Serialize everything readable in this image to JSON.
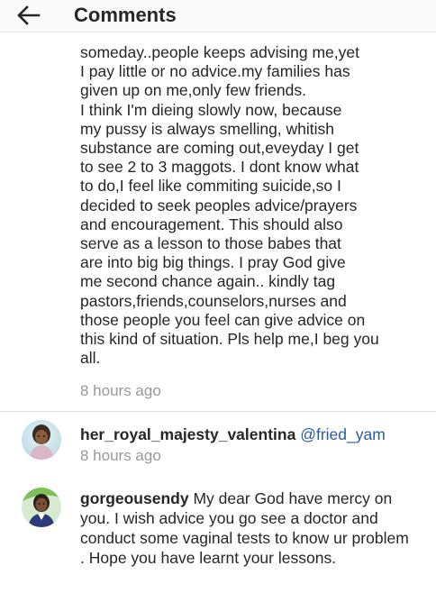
{
  "header": {
    "title": "Comments",
    "back_icon": "arrow-left-icon"
  },
  "comments": [
    {
      "text": "someday..people keeps advising me,yet\nI pay little or no advice.my families has\ngiven up on me,only few friends.\nI think I'm dieing slowly now, because\nmy pussy is always smelling, whitish\nsubstance are coming out,eveyday I get\nto see 2 to  3 maggots. I dont know what\nto do,I feel like commiting suicide,so I\ndecided to seek peoples advice/prayers\nand encouragement. This should also\nserve as a lesson to those babes that\nare into big big things. I pray God give\nme  second chance again.. kindly tag\npastors,friends,counselors,nurses and\nthose people you feel can give advice on\nthis kind of situation. Pls help me,I beg you\nall.",
      "time": "8 hours ago"
    },
    {
      "username": "her_royal_majesty_valentina",
      "mention": "@fried_yam",
      "time": "8 hours ago"
    },
    {
      "username": "gorgeousendy",
      "text": "My dear God have mercy on you. I wish advice you go see a doctor and conduct some vaginal tests to know ur problem . Hope you have learnt your lessons."
    }
  ],
  "colors": {
    "text": "#262626",
    "muted": "#999999",
    "mention": "#2b5aa5",
    "header_bg": "#fafafa"
  }
}
